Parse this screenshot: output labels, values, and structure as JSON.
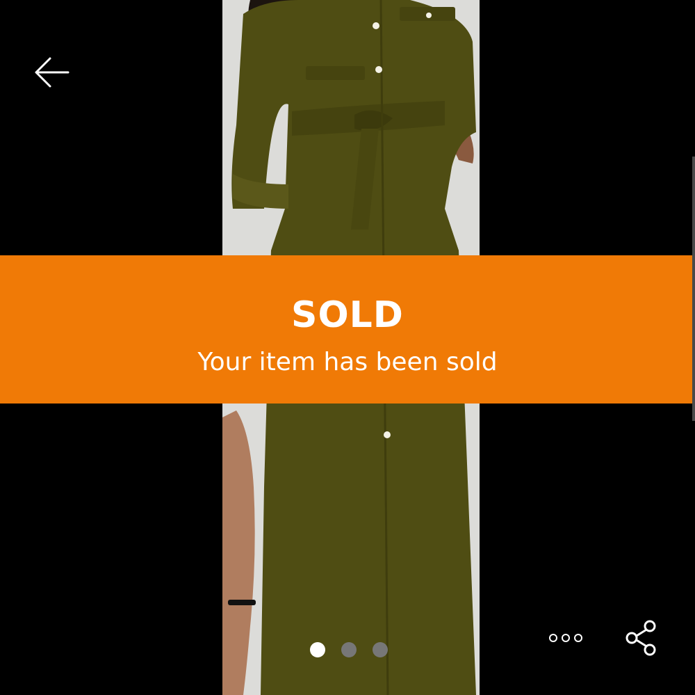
{
  "sold_banner": {
    "title": "SOLD",
    "subtitle": "Your item has been sold"
  },
  "gallery": {
    "image_count": 3,
    "current_index": 1
  },
  "icons": {
    "back": "arrow-left-icon",
    "more": "more-horizontal-icon",
    "share": "share-icon"
  },
  "colors": {
    "banner": "#f07a06",
    "dress": "#4f4d13",
    "background": "#000000",
    "dot_active": "#ffffff",
    "dot_inactive": "#777777"
  }
}
